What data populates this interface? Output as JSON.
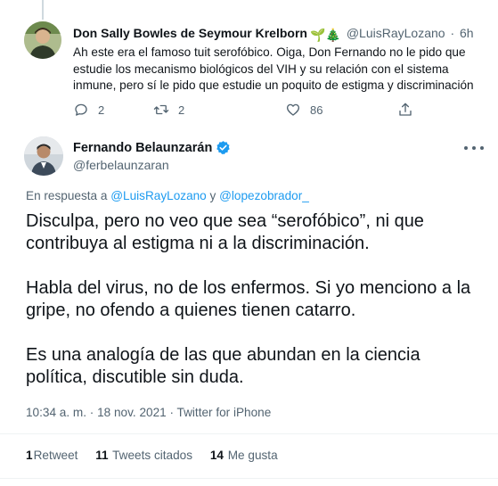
{
  "parent_tweet": {
    "author_name": "Don Sally Bowles de Seymour Krelborn",
    "author_emoji": "🌱🎄",
    "handle": "@LuisRayLozano",
    "separator": "·",
    "time": "6h",
    "text": "Ah este era el famoso tuit serofóbico. Oiga, Don Fernando no le pido que estudie los mecanismo biológicos del VIH y su relación con el sistema inmune, pero sí le pido que estudie un poquito de estigma y discriminación",
    "reply_count": "2",
    "retweet_count": "2",
    "like_count": "86"
  },
  "main_tweet": {
    "author_name": "Fernando Belaunzarán",
    "handle": "@ferbelaunzaran",
    "reply_prefix": "En respuesta a",
    "reply_user_1": "@LuisRayLozano",
    "reply_conjunction": "y",
    "reply_user_2": "@lopezobrador_",
    "paragraphs": [
      "Disculpa, pero no veo que sea “serofóbico”, ni que contribuya al estigma ni a la discriminación.",
      "Habla del virus, no de los enfermos. Si yo menciono a la gripe, no ofendo a quienes tienen catarro.",
      "Es una analogía de las que abundan en la ciencia política, discutible sin duda."
    ],
    "meta": "10:34 a. m. · 18 nov. 2021 · Twitter for iPhone",
    "stats": {
      "retweets_count": "1",
      "retweets_label": "Retweet",
      "quotes_count": "11",
      "quotes_label": "Tweets citados",
      "likes_count": "14",
      "likes_label": "Me gusta"
    }
  },
  "colors": {
    "accent": "#1d9bf0",
    "secondary_text": "#536471",
    "divider": "#eff3f4",
    "verified": "#1d9bf0"
  },
  "icons": [
    "reply-icon",
    "retweet-icon",
    "like-icon",
    "share-icon",
    "verified-icon",
    "more-icon"
  ]
}
